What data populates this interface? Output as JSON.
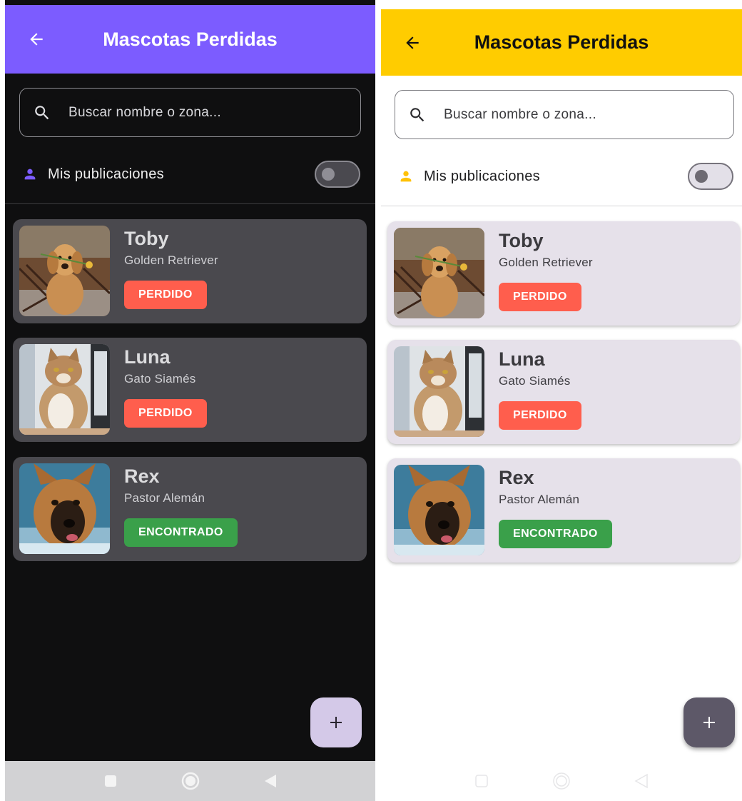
{
  "app": {
    "title": "Mascotas Perdidas",
    "search_placeholder": "Buscar nombre o zona...",
    "search_value": "",
    "filter_label": "Mis publicaciones",
    "filter_on": false
  },
  "themes": {
    "dark": {
      "appbar_color": "#7c5cff",
      "background": "#0f0f10",
      "card_color": "#4a494e",
      "fab_color": "#d4c9e8"
    },
    "light": {
      "appbar_color": "#ffcc00",
      "background": "#ffffff",
      "card_color": "#e6e1ea",
      "fab_color": "#5d5868"
    }
  },
  "status_colors": {
    "lost": "#ff5e4d",
    "found": "#3aa04a"
  },
  "pets": [
    {
      "name": "Toby",
      "breed": "Golden Retriever",
      "status": "PERDIDO",
      "photo_icon": "golden-retriever-photo"
    },
    {
      "name": "Luna",
      "breed": "Gato Siamés",
      "status": "PERDIDO",
      "photo_icon": "cat-photo"
    },
    {
      "name": "Rex",
      "breed": "Pastor Alemán",
      "status": "ENCONTRADO",
      "photo_icon": "german-shepherd-photo"
    }
  ],
  "icons": {
    "back": "arrow-left-icon",
    "search": "search-icon",
    "person": "person-icon",
    "add": "plus-icon",
    "nav": [
      "square-recents-icon",
      "circle-home-icon",
      "triangle-back-icon"
    ]
  }
}
